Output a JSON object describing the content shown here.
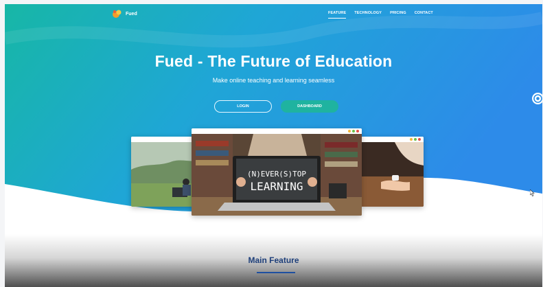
{
  "brand": {
    "name": "Fued",
    "logo_icon": "fued-logo-icon"
  },
  "nav": {
    "links": [
      {
        "label": "FEATURE",
        "active": true
      },
      {
        "label": "TECHNOLOGY",
        "active": false
      },
      {
        "label": "PRICING",
        "active": false
      },
      {
        "label": "CONTACT",
        "active": false
      }
    ]
  },
  "hero": {
    "title": "Fued - The Future of Education",
    "subtitle": "Make online teaching and learning seamless",
    "login_label": "LOGIN",
    "dashboard_label": "DASHBOARD"
  },
  "screenshots": {
    "center_laptop_text_line1": "(N)EVER(S)TOP",
    "center_laptop_text_line2": "LEARNING"
  },
  "side_widget_icon": "chat-bubble-icon",
  "section": {
    "title": "Main Feature"
  },
  "colors": {
    "gradient_start": "#1fb7a8",
    "gradient_end": "#2a8fe8",
    "dashboard_button": "#1fb3a0",
    "section_title": "#1e3f7a",
    "window_dots": [
      "#f5b63a",
      "#6cc04a",
      "#e8504a"
    ]
  }
}
